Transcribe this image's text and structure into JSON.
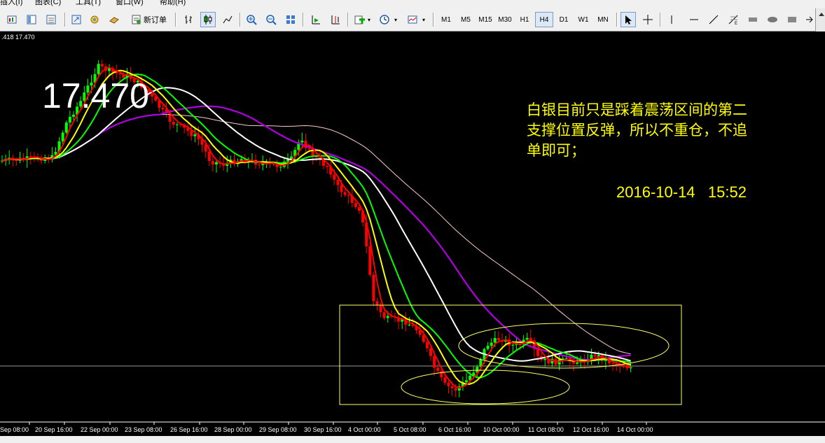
{
  "menu": [
    "插入(I)",
    "图表(C)",
    "工具(T)",
    "窗口(W)",
    "帮助(H)"
  ],
  "toolbar": {
    "new_order_label": "新订单",
    "timeframes": [
      "M1",
      "M5",
      "M15",
      "M30",
      "H1",
      "H4",
      "D1",
      "W1",
      "MN"
    ],
    "selected_timeframe": "H4"
  },
  "chart": {
    "header_price": ".418 17.470",
    "big_price": "17.470",
    "annotation_lines": [
      "白银目前只是踩着震荡区间的第二",
      "支撑位置反弹，所以不重仓，不追",
      "单即可；"
    ],
    "timestamp": "2016-10-14   15:52",
    "current_price": 17.47,
    "x_labels": [
      "Sep 08:00",
      "20 Sep 16:00",
      "22 Sep 00:00",
      "23 Sep 08:00",
      "26 Sep 16:00",
      "28 Sep 00:00",
      "29 Sep 08:00",
      "30 Sep 16:00",
      "4 Oct 00:00",
      "5 Oct 08:00",
      "6 Oct 16:00",
      "10 Oct 00:00",
      "11 Oct 08:00",
      "12 Oct 16:00",
      "14 Oct 00:00"
    ],
    "colors": {
      "background": "#000000",
      "bull": "#00ff00",
      "bear": "#ff0000",
      "text": "#ffffff",
      "annotation": "#ffff00",
      "ma_red": "#ff0000",
      "ma_yellow": "#ffff00",
      "ma_green": "#00ff00",
      "ma_white": "#ffffff",
      "ma_purple": "#b000e0",
      "ma_pink": "#ffc8c8",
      "shapes": "#ffff66"
    }
  }
}
